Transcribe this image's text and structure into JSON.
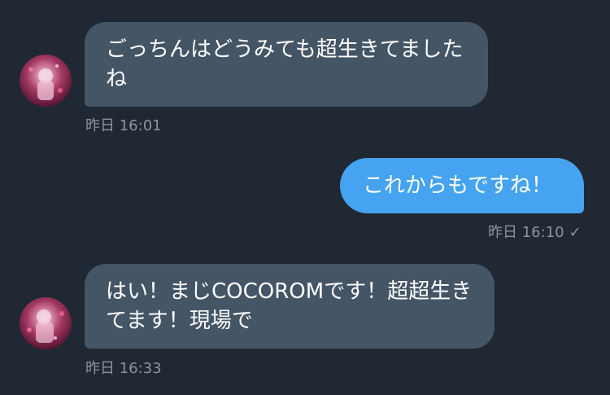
{
  "messages": [
    {
      "direction": "incoming",
      "text": "ごっちんはどうみても超生きてましたね",
      "timestamp": "昨日 16:01"
    },
    {
      "direction": "outgoing",
      "text": "これからもですね！",
      "timestamp": "昨日 16:10",
      "status_icon": "checkmark-icon"
    },
    {
      "direction": "incoming",
      "text": "はい！まじCOCOROMです！超超生きてます！現場で",
      "timestamp": "昨日 16:33"
    }
  ],
  "colors": {
    "background": "#1f2833",
    "incoming_bubble": "#445565",
    "outgoing_bubble": "#45a3ef",
    "meta_text": "#8a95a1"
  }
}
